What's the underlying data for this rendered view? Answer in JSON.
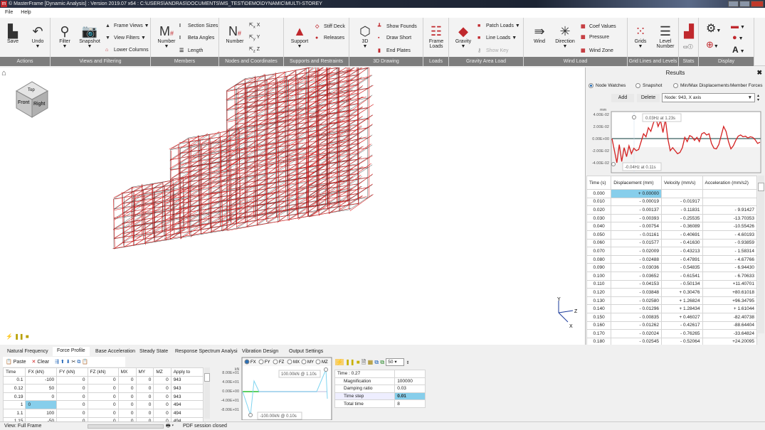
{
  "window": {
    "title": "© MasterFrame [Dynamic Analysis] : Version 2019.07 x64 : C:\\USERS\\ANDRAS\\DOCUMENTS\\MS_TEST\\DEMO\\DYNAMIC\\MULTI-STOREY",
    "logo": "m"
  },
  "menu": [
    "File",
    "Help"
  ],
  "ribbon": {
    "actions": {
      "label": "Actions",
      "save": "Save",
      "undo": "Undo"
    },
    "views": {
      "label": "Views and Filtering",
      "filter": "Filter",
      "snapshot": "Snapshot",
      "frame_views": "Frame Views",
      "view_filters": "View Filters",
      "lower_columns": "Lower Columns"
    },
    "members": {
      "label": "Members",
      "number": "Number",
      "section_sizes": "Section Sizes",
      "beta_angles": "Beta Angles",
      "length": "Length"
    },
    "nodes": {
      "label": "Nodes and Coordinates",
      "number": "Number",
      "x": "X",
      "y": "Y",
      "z": "Z"
    },
    "supports": {
      "label": "Supports and Restraints",
      "support": "Support",
      "stiff_deck": "Stiff Deck",
      "releases": "Releases"
    },
    "drawing": {
      "label": "3D Drawing",
      "3d": "3D",
      "show_founds": "Show Founds",
      "draw_short": "Draw Short",
      "end_plates": "End Plates"
    },
    "loads": {
      "label": "Loads",
      "frame_loads": "Frame Loads"
    },
    "gravity": {
      "label": "Gravity Area Load",
      "gravity": "Gravity",
      "patch_loads": "Patch Loads",
      "line_loads": "Line Loads",
      "show_key": "Show Key"
    },
    "wind": {
      "label": "Wind Load",
      "wind": "Wind",
      "direction": "Direction",
      "coef_values": "Coef Values",
      "pressure": "Pressure",
      "wind_zone": "Wind Zone"
    },
    "grid": {
      "label": "Grid Lines and Levels",
      "grids": "Grids",
      "level_number": "Level Number"
    },
    "stats": {
      "label": "Stats"
    },
    "display": {
      "label": "Display"
    }
  },
  "viewcube": {
    "top": "Top",
    "front": "Front",
    "right": "Right"
  },
  "axes": {
    "x": "X",
    "y": "Y",
    "z": "Z"
  },
  "results": {
    "title": "Results",
    "modes": [
      {
        "label": "Node Watches",
        "selected": true
      },
      {
        "label": "Snapshot",
        "selected": false
      },
      {
        "label": "Min/Max Displacements",
        "selected": false
      }
    ],
    "member_forces": "Member Forces",
    "add": "Add",
    "delete": "Delete",
    "node_select": "Node: 943, X axis",
    "chart": {
      "unit": "mm",
      "yticks": [
        "4.00E-02",
        "2.00E-02",
        "0.00E+00",
        "-2.00E-02",
        "-4.00E-02"
      ],
      "max_label": "0.03Hz at 1.23s",
      "min_label": "-0.04Hz at 0.11s",
      "line_color": "#d42020"
    },
    "columns": [
      "Time (s)",
      "Displacement (mm)",
      "Velocity (mm/s)",
      "Acceleration (mm/s2)"
    ],
    "rows": [
      [
        "0.000",
        "+ 0.00000",
        "",
        ""
      ],
      [
        "0.010",
        "- 0.00019",
        "- 0.01917",
        ""
      ],
      [
        "0.020",
        "- 0.00137",
        "- 0.11831",
        "- 9.91427"
      ],
      [
        "0.030",
        "- 0.00393",
        "- 0.25535",
        "-13.70353"
      ],
      [
        "0.040",
        "- 0.00754",
        "- 0.36089",
        "-10.55426"
      ],
      [
        "0.050",
        "- 0.01161",
        "- 0.40691",
        "- 4.60193"
      ],
      [
        "0.060",
        "- 0.01577",
        "- 0.41630",
        "- 0.93859"
      ],
      [
        "0.070",
        "- 0.02009",
        "- 0.43213",
        "- 1.58314"
      ],
      [
        "0.080",
        "- 0.02488",
        "- 0.47891",
        "- 4.67766"
      ],
      [
        "0.090",
        "- 0.03036",
        "- 0.54835",
        "- 6.94430"
      ],
      [
        "0.100",
        "- 0.03652",
        "- 0.61541",
        "- 6.70633"
      ],
      [
        "0.110",
        "- 0.04153",
        "- 0.50134",
        "+11.40701"
      ],
      [
        "0.120",
        "- 0.03848",
        "+ 0.30476",
        "+80.61018"
      ],
      [
        "0.130",
        "- 0.02580",
        "+ 1.26824",
        "+96.34795"
      ],
      [
        "0.140",
        "- 0.01296",
        "+ 1.28434",
        "+ 1.61044"
      ],
      [
        "0.150",
        "- 0.00835",
        "+ 0.46027",
        "-82.40738"
      ],
      [
        "0.160",
        "- 0.01262",
        "- 0.42617",
        "-88.64404"
      ],
      [
        "0.170",
        "- 0.02024",
        "- 0.76265",
        "-33.64824"
      ],
      [
        "0.180",
        "- 0.02545",
        "- 0.52064",
        "+24.20095"
      ]
    ]
  },
  "bottom": {
    "tabs": [
      "Natural Frequency",
      "Force Profile",
      "Base Acceleration",
      "Steady State",
      "Response Spectrum Analysis",
      "Vibration Design",
      "Output Settings"
    ],
    "active_tab": 1,
    "toolbar": {
      "paste": "Paste",
      "clear": "Clear"
    },
    "force_columns": [
      "Time",
      "FX (kN)",
      "FY (kN)",
      "FZ (kN)",
      "MX",
      "MY",
      "MZ",
      "Apply to"
    ],
    "force_rows": [
      [
        "0.1",
        "-100",
        "0",
        "0",
        "0",
        "0",
        "0",
        "943"
      ],
      [
        "0.12",
        "50",
        "0",
        "0",
        "0",
        "0",
        "0",
        "943"
      ],
      [
        "0.19",
        "0",
        "0",
        "0",
        "0",
        "0",
        "0",
        "943"
      ],
      [
        "1",
        "0",
        "0",
        "0",
        "0",
        "0",
        "0",
        "494"
      ],
      [
        "1.1",
        "100",
        "0",
        "0",
        "0",
        "0",
        "0",
        "494"
      ],
      [
        "1.15",
        "-50",
        "0",
        "0",
        "0",
        "0",
        "0",
        "494"
      ]
    ],
    "force_chart": {
      "components": [
        "FX",
        "FY",
        "FZ",
        "MX",
        "MY",
        "MZ"
      ],
      "selected": "FX",
      "unit": "kN",
      "yticks": [
        "8.00E+01",
        "4.00E+01",
        "0.00E+00",
        "-4.00E+01",
        "-8.00E+01"
      ],
      "max_label": "100.00kN @ 1.10s",
      "min_label": "-100.00kN @ 0.10s",
      "line_color": "#7fd4f0"
    },
    "speed": "50",
    "props": {
      "header": "Time : 0.27",
      "rows": [
        [
          "Magnification",
          "100000"
        ],
        [
          "Damping ratio",
          "0.03"
        ],
        [
          "Time step",
          "0.01"
        ],
        [
          "Total time",
          "8"
        ]
      ]
    }
  },
  "status": {
    "view": "View: Full Frame",
    "pdf": "PDF session closed"
  }
}
